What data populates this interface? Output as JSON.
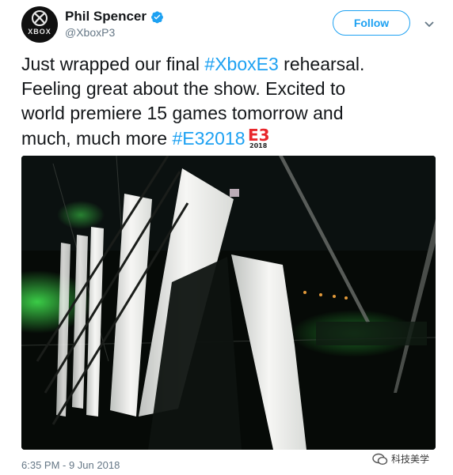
{
  "author": {
    "display_name": "Phil Spencer",
    "handle": "@XboxP3",
    "verified": true,
    "avatar_text": "XBOX"
  },
  "follow_button": {
    "label": "Follow"
  },
  "tweet": {
    "lines": [
      {
        "plain_before": "Just wrapped our final ",
        "hashtag": "#XboxE3",
        "plain_after": " rehearsal."
      },
      {
        "plain_before": "Feeling great about the show. Excited to",
        "hashtag": "",
        "plain_after": ""
      },
      {
        "plain_before": "world premiere 15 games tomorrow and",
        "hashtag": "",
        "plain_after": ""
      },
      {
        "plain_before": "much, much more ",
        "hashtag": "#E32018",
        "plain_after": ""
      }
    ],
    "e3_logo": {
      "letters": "E3",
      "year": "2018"
    }
  },
  "timestamp": "6:35 PM - 9 Jun 2018",
  "watermark": {
    "text": "科技美学"
  },
  "colors": {
    "link": "#1da1f2",
    "meta": "#657786",
    "stage_green": "#3dd64a"
  },
  "icons": [
    "verified-badge-icon",
    "chevron-down-icon",
    "xbox-logo-icon",
    "e3-emoji-icon",
    "wechat-icon"
  ]
}
